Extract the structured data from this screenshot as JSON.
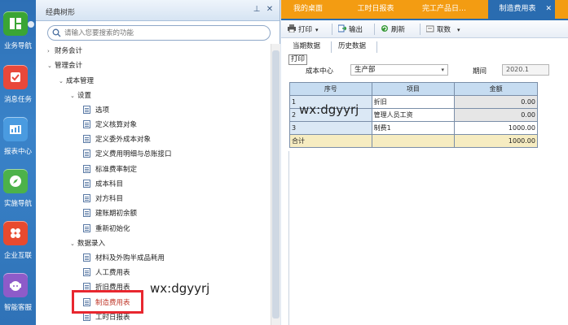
{
  "nav": {
    "items": [
      {
        "label": "业务导航"
      },
      {
        "label": "消息任务"
      },
      {
        "label": "报表中心"
      },
      {
        "label": "实施导航"
      },
      {
        "label": "企业互联"
      },
      {
        "label": "智能客服"
      }
    ]
  },
  "tree": {
    "title": "经典树形",
    "search_placeholder": "请输入您要搜索的功能",
    "rows": [
      {
        "label": "财务会计",
        "level": 1,
        "toggle": "›",
        "icon": false
      },
      {
        "label": "管理会计",
        "level": 1,
        "toggle": "⌄",
        "icon": false
      },
      {
        "label": "成本管理",
        "level": 2,
        "toggle": "⌄",
        "icon": false
      },
      {
        "label": "设置",
        "level": 3,
        "toggle": "⌄",
        "icon": false
      },
      {
        "label": "选项",
        "level": 4,
        "toggle": "",
        "icon": true
      },
      {
        "label": "定义核算对象",
        "level": 4,
        "toggle": "",
        "icon": true
      },
      {
        "label": "定义委外成本对象",
        "level": 4,
        "toggle": "",
        "icon": true
      },
      {
        "label": "定义费用明细与总账接口",
        "level": 4,
        "toggle": "",
        "icon": true
      },
      {
        "label": "标准费率制定",
        "level": 4,
        "toggle": "",
        "icon": true
      },
      {
        "label": "成本科目",
        "level": 4,
        "toggle": "",
        "icon": true
      },
      {
        "label": "对方科目",
        "level": 4,
        "toggle": "",
        "icon": true
      },
      {
        "label": "建账期初余额",
        "level": 4,
        "toggle": "",
        "icon": true
      },
      {
        "label": "重新初始化",
        "level": 4,
        "toggle": "",
        "icon": true
      },
      {
        "label": "数据录入",
        "level": 3,
        "toggle": "⌄",
        "icon": false
      },
      {
        "label": "材料及外购半成品耗用",
        "level": 4,
        "toggle": "",
        "icon": true
      },
      {
        "label": "人工费用表",
        "level": 4,
        "toggle": "",
        "icon": true
      },
      {
        "label": "折旧费用表",
        "level": 4,
        "toggle": "",
        "icon": true
      },
      {
        "label": "制造费用表",
        "level": 4,
        "toggle": "",
        "icon": true
      },
      {
        "label": "工时日报表",
        "level": 4,
        "toggle": "",
        "icon": true
      }
    ]
  },
  "watermark": "wx:dgyyrj",
  "tabs": [
    {
      "label": "我的桌面"
    },
    {
      "label": "工时日报表"
    },
    {
      "label": "完工产品日…"
    },
    {
      "label": "制造费用表",
      "active": true
    }
  ],
  "toolbar": {
    "print": "打印",
    "export": "输出",
    "refresh": "刷新",
    "fetch": "取数"
  },
  "subtabs": {
    "current": "当期数据",
    "history": "历史数据"
  },
  "print_label": "打印",
  "form": {
    "cost_center_label": "成本中心",
    "cost_center_value": "生产部",
    "period_label": "期间",
    "period_value": "2020.1"
  },
  "grid": {
    "headers": [
      "序号",
      "项目",
      "金额"
    ],
    "rows": [
      {
        "idx": "1",
        "item": "折旧",
        "amount": "0.00",
        "gray": true
      },
      {
        "idx": "2",
        "item": "管理人员工资",
        "amount": "0.00",
        "gray": true
      },
      {
        "idx": "3",
        "item": "制费1",
        "amount": "1000.00",
        "gray": false
      }
    ],
    "total": {
      "label": "合计",
      "amount": "1000.00"
    }
  },
  "colors": {
    "tab_bar": "#f39c12",
    "tab_active": "#2a6cb0",
    "highlight": "#e8272f",
    "nav_bg": "#2f72b7"
  }
}
